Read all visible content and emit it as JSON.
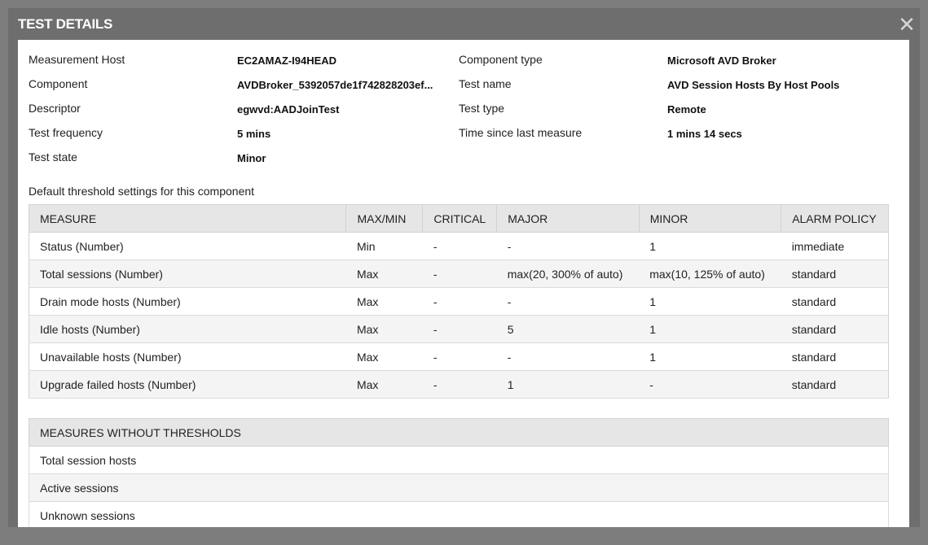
{
  "dialog": {
    "title": "TEST DETAILS",
    "close_glyph": "✕"
  },
  "info": {
    "measurement_host_label": "Measurement Host",
    "measurement_host_value": "EC2AMAZ-I94HEAD",
    "component_label": "Component",
    "component_value": "AVDBroker_5392057de1f742828203ef...",
    "descriptor_label": "Descriptor",
    "descriptor_value": "egwvd:AADJoinTest",
    "test_frequency_label": "Test frequency",
    "test_frequency_value": "5 mins",
    "test_state_label": "Test state",
    "test_state_value": "Minor",
    "component_type_label": "Component type",
    "component_type_value": "Microsoft AVD Broker",
    "test_name_label": "Test name",
    "test_name_value": "AVD Session Hosts By Host Pools",
    "test_type_label": "Test type",
    "test_type_value": "Remote",
    "time_since_label": "Time since last measure",
    "time_since_value": "1 mins 14 secs"
  },
  "thresholds": {
    "caption": "Default threshold settings for this component",
    "headers": [
      "MEASURE",
      "MAX/MIN",
      "CRITICAL",
      "MAJOR",
      "MINOR",
      "ALARM POLICY"
    ],
    "rows": [
      [
        "Status (Number)",
        "Min",
        "-",
        "-",
        "1",
        "immediate"
      ],
      [
        "Total sessions (Number)",
        "Max",
        "-",
        "max(20, 300% of auto)",
        "max(10, 125% of auto)",
        "standard"
      ],
      [
        "Drain mode hosts (Number)",
        "Max",
        "-",
        "-",
        "1",
        "standard"
      ],
      [
        "Idle hosts (Number)",
        "Max",
        "-",
        "5",
        "1",
        "standard"
      ],
      [
        "Unavailable hosts (Number)",
        "Max",
        "-",
        "-",
        "1",
        "standard"
      ],
      [
        "Upgrade failed hosts (Number)",
        "Max",
        "-",
        "1",
        "-",
        "standard"
      ]
    ]
  },
  "no_thresholds": {
    "header": "MEASURES WITHOUT THRESHOLDS",
    "rows": [
      "Total session hosts",
      "Active sessions",
      "Unknown sessions"
    ]
  },
  "colors": {
    "overlay": "#7d7d7d",
    "dialog_bar": "#6e6e6e",
    "header_bg": "#e6e6e6",
    "row_alt": "#f4f4f4"
  }
}
